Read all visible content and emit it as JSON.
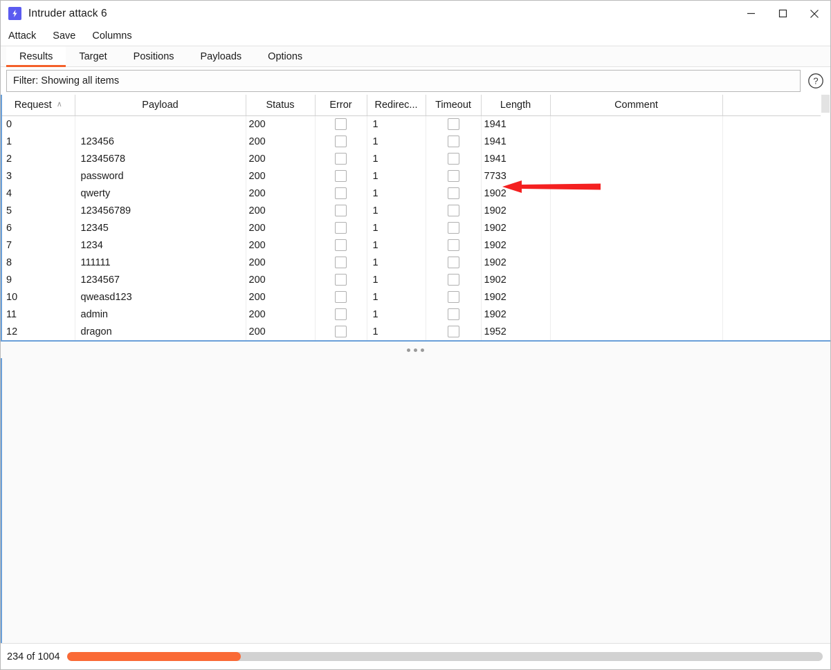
{
  "window": {
    "title": "Intruder attack 6",
    "icon": "lightning-bolt-icon",
    "accent_color": "#5b5bf0",
    "controls": {
      "minimize": "minimize-icon",
      "maximize": "maximize-icon",
      "close": "close-icon"
    }
  },
  "menubar": {
    "items": [
      {
        "label": "Attack"
      },
      {
        "label": "Save"
      },
      {
        "label": "Columns"
      }
    ]
  },
  "tabs": {
    "active": "Results",
    "active_underline_color": "#f4602a",
    "items": [
      {
        "label": "Results"
      },
      {
        "label": "Target"
      },
      {
        "label": "Positions"
      },
      {
        "label": "Payloads"
      },
      {
        "label": "Options"
      }
    ]
  },
  "filter": {
    "text": "Filter: Showing all items",
    "help_icon": "question-mark-circle-icon"
  },
  "table": {
    "columns": [
      {
        "key": "request",
        "label": "Request",
        "sorted": "asc",
        "sort_caret": "∧"
      },
      {
        "key": "payload",
        "label": "Payload"
      },
      {
        "key": "status",
        "label": "Status"
      },
      {
        "key": "error",
        "label": "Error"
      },
      {
        "key": "redirect",
        "label": "Redirec..."
      },
      {
        "key": "timeout",
        "label": "Timeout"
      },
      {
        "key": "length",
        "label": "Length"
      },
      {
        "key": "comment",
        "label": "Comment"
      },
      {
        "key": "extra",
        "label": ""
      }
    ],
    "rows": [
      {
        "request": "0",
        "payload": "",
        "status": "200",
        "error": false,
        "redirect": "1",
        "timeout": false,
        "length": "1941",
        "comment": ""
      },
      {
        "request": "1",
        "payload": "123456",
        "status": "200",
        "error": false,
        "redirect": "1",
        "timeout": false,
        "length": "1941",
        "comment": ""
      },
      {
        "request": "2",
        "payload": "12345678",
        "status": "200",
        "error": false,
        "redirect": "1",
        "timeout": false,
        "length": "1941",
        "comment": ""
      },
      {
        "request": "3",
        "payload": "password",
        "status": "200",
        "error": false,
        "redirect": "1",
        "timeout": false,
        "length": "7733",
        "comment": ""
      },
      {
        "request": "4",
        "payload": "qwerty",
        "status": "200",
        "error": false,
        "redirect": "1",
        "timeout": false,
        "length": "1902",
        "comment": ""
      },
      {
        "request": "5",
        "payload": "123456789",
        "status": "200",
        "error": false,
        "redirect": "1",
        "timeout": false,
        "length": "1902",
        "comment": ""
      },
      {
        "request": "6",
        "payload": "12345",
        "status": "200",
        "error": false,
        "redirect": "1",
        "timeout": false,
        "length": "1902",
        "comment": ""
      },
      {
        "request": "7",
        "payload": "1234",
        "status": "200",
        "error": false,
        "redirect": "1",
        "timeout": false,
        "length": "1902",
        "comment": ""
      },
      {
        "request": "8",
        "payload": "111111",
        "status": "200",
        "error": false,
        "redirect": "1",
        "timeout": false,
        "length": "1902",
        "comment": ""
      },
      {
        "request": "9",
        "payload": "1234567",
        "status": "200",
        "error": false,
        "redirect": "1",
        "timeout": false,
        "length": "1902",
        "comment": ""
      },
      {
        "request": "10",
        "payload": "qweasd123",
        "status": "200",
        "error": false,
        "redirect": "1",
        "timeout": false,
        "length": "1902",
        "comment": ""
      },
      {
        "request": "11",
        "payload": "admin",
        "status": "200",
        "error": false,
        "redirect": "1",
        "timeout": false,
        "length": "1902",
        "comment": ""
      },
      {
        "request": "12",
        "payload": "dragon",
        "status": "200",
        "error": false,
        "redirect": "1",
        "timeout": false,
        "length": "1952",
        "comment": ""
      }
    ]
  },
  "annotation": {
    "type": "arrow",
    "color": "#f42020",
    "points_to": "length-value-7733"
  },
  "statusbar": {
    "text": "234 of 1004",
    "progress_percent": 23,
    "progress_color": "#fa6a36",
    "track_color": "#d2d2d2"
  }
}
